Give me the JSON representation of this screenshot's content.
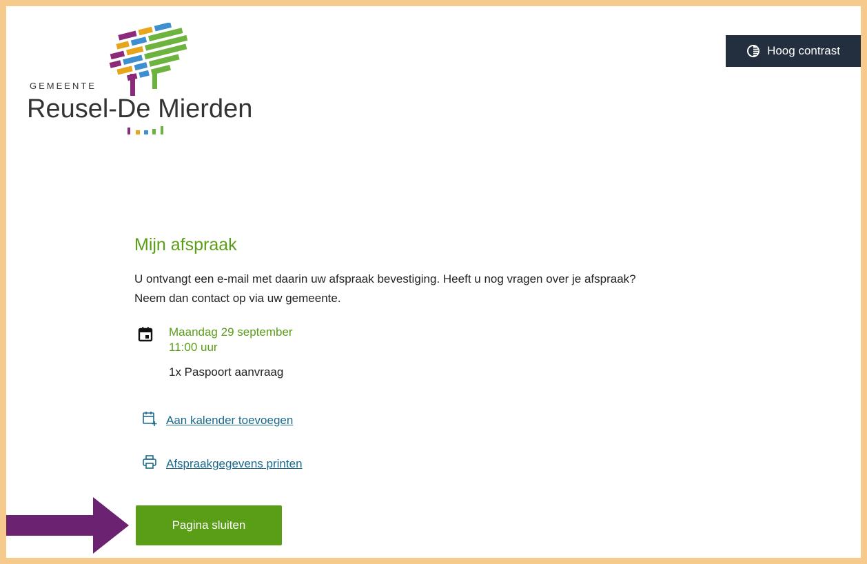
{
  "header": {
    "logo": {
      "line1": "GEMEENTE",
      "line2": "Reusel-De Mierden"
    },
    "contrast_button": {
      "label": "Hoog contrast",
      "icon": "contrast-icon"
    }
  },
  "main": {
    "title": "Mijn afspraak",
    "intro_line1": "U ontvangt een e-mail met daarin uw afspraak bevestiging. Heeft u nog vragen over je afspraak?",
    "intro_line2": "Neem dan contact op via uw gemeente.",
    "appointment": {
      "date": "Maandag 29 september",
      "time": "11:00 uur",
      "service": "1x Paspoort aanvraag",
      "icon": "calendar-icon"
    },
    "links": {
      "add_to_calendar": "Aan kalender toevoegen",
      "print": "Afspraakgegevens printen"
    },
    "close_button": "Pagina sluiten"
  },
  "colors": {
    "accent_green": "#5a9e18",
    "link_blue": "#1a6a8c",
    "frame_border": "#f6c98d",
    "contrast_button_bg": "#232f3e",
    "arrow_purple": "#6b2270"
  }
}
